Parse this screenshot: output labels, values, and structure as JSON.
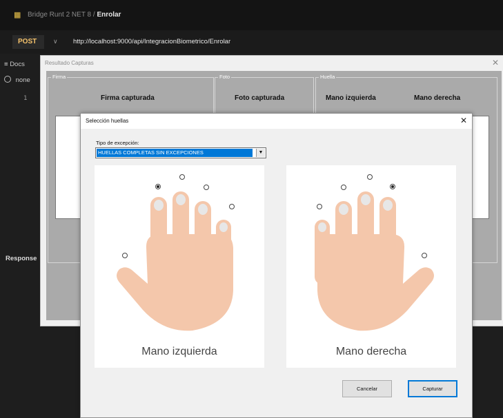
{
  "app": {
    "title_prefix": "Bridge Runt 2 NET 8",
    "title_sep": "/",
    "title_page": "Enrolar",
    "method": "POST",
    "url": "http://localhost:9000/api/IntegracionBiometrico/Enrolar",
    "sidebar": {
      "docs": "Docs",
      "none": "none",
      "line_number": "1",
      "response": "Response"
    }
  },
  "result_window": {
    "title": "Resultado Capturas",
    "groups": {
      "firma": {
        "legend": "Firma",
        "heading": "Firma capturada"
      },
      "foto": {
        "legend": "Foto",
        "heading": "Foto capturada"
      },
      "huella": {
        "legend": "Huella",
        "left": "Mano izquierda",
        "right": "Mano derecha"
      }
    }
  },
  "dialog": {
    "title": "Selección  huellas",
    "tipo_label": "Tipo de excepción:",
    "tipo_value": "HUELLAS COMPLETAS SIN EXCEPCIONES",
    "left_hand": {
      "label": "Mano izquierda",
      "fingers": {
        "little": false,
        "ring": true,
        "middle": false,
        "index": false,
        "thumb": false
      }
    },
    "right_hand": {
      "label": "Mano derecha",
      "fingers": {
        "thumb": false,
        "index": false,
        "middle": false,
        "ring": true,
        "little": false
      }
    },
    "buttons": {
      "cancel": "Cancelar",
      "capture": "Capturar"
    }
  },
  "colors": {
    "skin": "#f4c7ab",
    "nail": "#e6e6e6",
    "highlight": "#0078d7",
    "accent": "#f5c26b"
  }
}
